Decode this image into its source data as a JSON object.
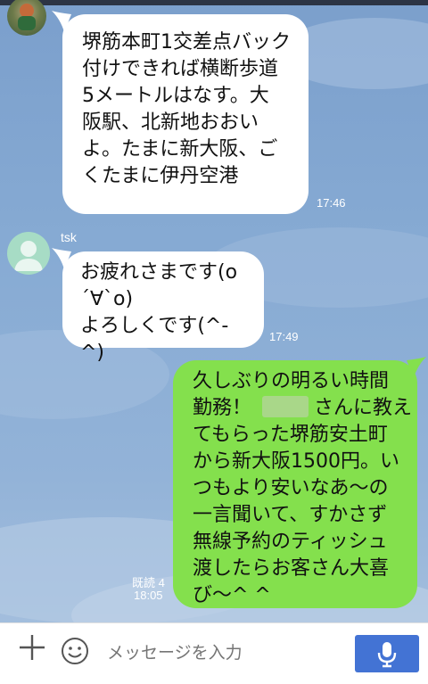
{
  "messages": [
    {
      "type": "received",
      "text": "堺筋本町1交差点バック\n付けできれば横断歩道\n5メートルはなす。大\n阪駅、北新地おおい\nよ。たまに新大阪、ご\nくたまに伊丹空港",
      "time": "17:46"
    },
    {
      "type": "received",
      "sender": "tsk",
      "text": "お疲れさまです(o\n´∀`o)\nよろしくです(^-^)",
      "time": "17:49"
    },
    {
      "type": "sent",
      "lines": [
        "久しぶりの明るい時間",
        "勤務！",
        "さんに教え",
        "てもらった堺筋安土町",
        "から新大阪1500円。い",
        "つもより安いなあ〜の",
        "一言聞いて、すかさず",
        "無線予約のティッシュ",
        "渡したらお客さん大喜",
        "び〜^ ^"
      ],
      "read": "既読 4",
      "time": "18:05"
    }
  ],
  "input": {
    "placeholder": "メッセージを入力"
  },
  "icons": {
    "plus": "plus-icon",
    "emoji": "smiley-icon",
    "mic": "microphone-icon"
  },
  "colors": {
    "sent_bubble": "#84e04d",
    "received_bubble": "#ffffff",
    "send_button": "#4373d4",
    "background": "#86aad3"
  }
}
